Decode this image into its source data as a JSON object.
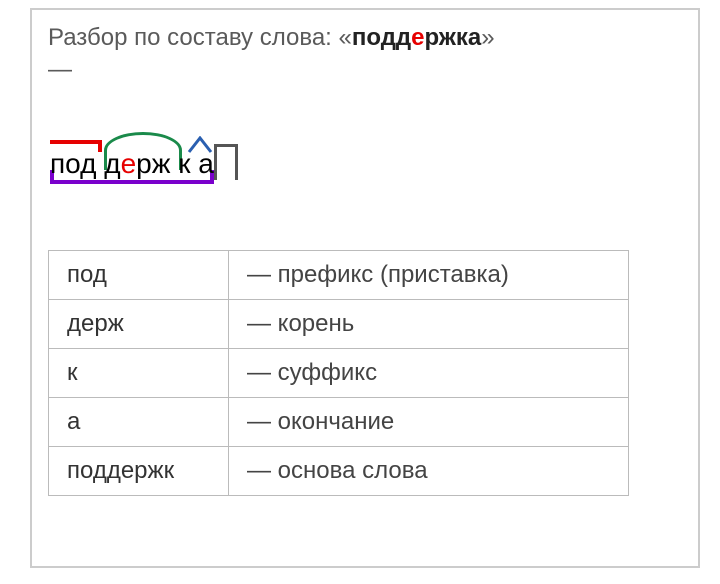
{
  "intro_prefix": "Разбор по составу слова: «",
  "intro_word_before": "подд",
  "intro_word_highlight": "е",
  "intro_word_after": "ржка",
  "intro_suffix": "»",
  "dash": "—",
  "diagram": {
    "prefix": "под",
    "root_before": " д",
    "root_hl": "е",
    "root_after": "рж",
    "suffix": " к",
    "ending": " а"
  },
  "table_rows": [
    {
      "morph": "под",
      "desc": "— префикс (приставка)"
    },
    {
      "morph": "держ",
      "desc": "— корень"
    },
    {
      "morph": "к",
      "desc": "— суффикс"
    },
    {
      "morph": "а",
      "desc": "— окончание"
    },
    {
      "morph": "поддержк",
      "desc": "— основа слова"
    }
  ]
}
